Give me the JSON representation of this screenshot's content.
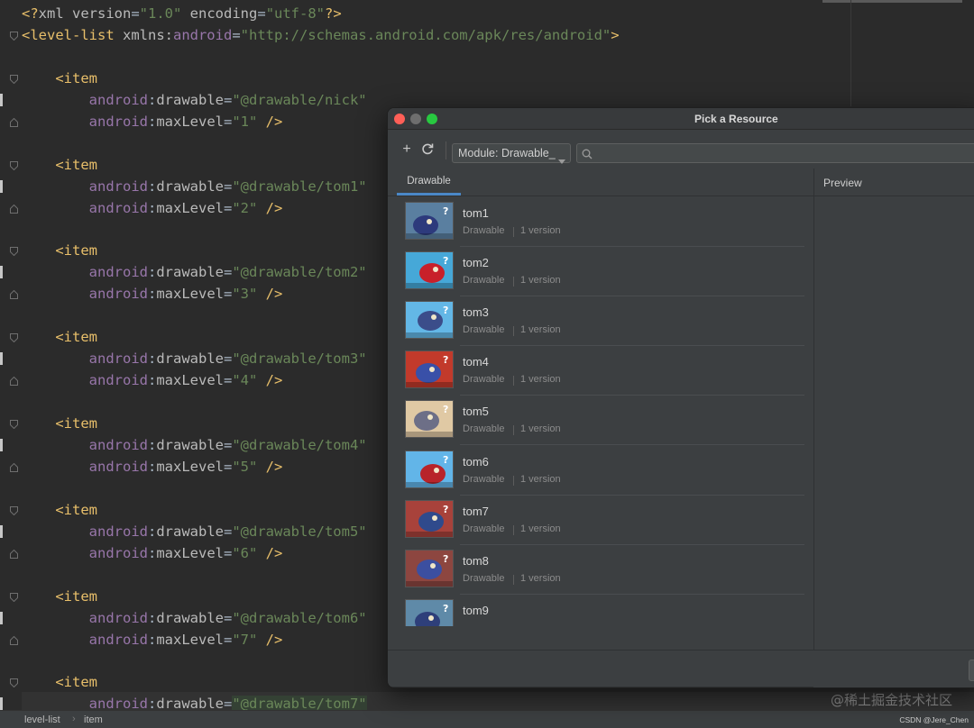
{
  "editor": {
    "lines": [
      [
        [
          "t-decl",
          "<?"
        ],
        [
          "t-attr",
          "xml version"
        ],
        [
          "",
          "="
        ],
        [
          "t-val",
          "\"1.0\""
        ],
        [
          "t-attr",
          " encoding"
        ],
        [
          "",
          "="
        ],
        [
          "t-val",
          "\"utf-8\""
        ],
        [
          "t-decl",
          "?>"
        ]
      ],
      [
        [
          "t-tag",
          "<level-list"
        ],
        [
          "t-attr",
          " xmlns:"
        ],
        [
          "t-ns",
          "android"
        ],
        [
          "",
          "="
        ],
        [
          "t-val",
          "\"http://schemas.android.com/apk/res/android\""
        ],
        [
          "t-tag",
          ">"
        ]
      ],
      [],
      [
        [
          "t-tag",
          "    <item"
        ]
      ],
      [
        [
          "t-ns",
          "        android"
        ],
        [
          "",
          ":"
        ],
        [
          "t-attr",
          "drawable"
        ],
        [
          "",
          "="
        ],
        [
          "t-val",
          "\"@drawable/nick\""
        ]
      ],
      [
        [
          "t-ns",
          "        android"
        ],
        [
          "",
          ":"
        ],
        [
          "t-attr",
          "maxLevel"
        ],
        [
          "",
          "="
        ],
        [
          "t-val",
          "\"1\""
        ],
        [
          "t-tag",
          " />"
        ]
      ],
      [],
      [
        [
          "t-tag",
          "    <item"
        ]
      ],
      [
        [
          "t-ns",
          "        android"
        ],
        [
          "",
          ":"
        ],
        [
          "t-attr",
          "drawable"
        ],
        [
          "",
          "="
        ],
        [
          "t-val",
          "\"@drawable/tom1\""
        ]
      ],
      [
        [
          "t-ns",
          "        android"
        ],
        [
          "",
          ":"
        ],
        [
          "t-attr",
          "maxLevel"
        ],
        [
          "",
          "="
        ],
        [
          "t-val",
          "\"2\""
        ],
        [
          "t-tag",
          " />"
        ]
      ],
      [],
      [
        [
          "t-tag",
          "    <item"
        ]
      ],
      [
        [
          "t-ns",
          "        android"
        ],
        [
          "",
          ":"
        ],
        [
          "t-attr",
          "drawable"
        ],
        [
          "",
          "="
        ],
        [
          "t-val",
          "\"@drawable/tom2\""
        ]
      ],
      [
        [
          "t-ns",
          "        android"
        ],
        [
          "",
          ":"
        ],
        [
          "t-attr",
          "maxLevel"
        ],
        [
          "",
          "="
        ],
        [
          "t-val",
          "\"3\""
        ],
        [
          "t-tag",
          " />"
        ]
      ],
      [],
      [
        [
          "t-tag",
          "    <item"
        ]
      ],
      [
        [
          "t-ns",
          "        android"
        ],
        [
          "",
          ":"
        ],
        [
          "t-attr",
          "drawable"
        ],
        [
          "",
          "="
        ],
        [
          "t-val",
          "\"@drawable/tom3\""
        ]
      ],
      [
        [
          "t-ns",
          "        android"
        ],
        [
          "",
          ":"
        ],
        [
          "t-attr",
          "maxLevel"
        ],
        [
          "",
          "="
        ],
        [
          "t-val",
          "\"4\""
        ],
        [
          "t-tag",
          " />"
        ]
      ],
      [],
      [
        [
          "t-tag",
          "    <item"
        ]
      ],
      [
        [
          "t-ns",
          "        android"
        ],
        [
          "",
          ":"
        ],
        [
          "t-attr",
          "drawable"
        ],
        [
          "",
          "="
        ],
        [
          "t-val",
          "\"@drawable/tom4\""
        ]
      ],
      [
        [
          "t-ns",
          "        android"
        ],
        [
          "",
          ":"
        ],
        [
          "t-attr",
          "maxLevel"
        ],
        [
          "",
          "="
        ],
        [
          "t-val",
          "\"5\""
        ],
        [
          "t-tag",
          " />"
        ]
      ],
      [],
      [
        [
          "t-tag",
          "    <item"
        ]
      ],
      [
        [
          "t-ns",
          "        android"
        ],
        [
          "",
          ":"
        ],
        [
          "t-attr",
          "drawable"
        ],
        [
          "",
          "="
        ],
        [
          "t-val",
          "\"@drawable/tom5\""
        ]
      ],
      [
        [
          "t-ns",
          "        android"
        ],
        [
          "",
          ":"
        ],
        [
          "t-attr",
          "maxLevel"
        ],
        [
          "",
          "="
        ],
        [
          "t-val",
          "\"6\""
        ],
        [
          "t-tag",
          " />"
        ]
      ],
      [],
      [
        [
          "t-tag",
          "    <item"
        ]
      ],
      [
        [
          "t-ns",
          "        android"
        ],
        [
          "",
          ":"
        ],
        [
          "t-attr",
          "drawable"
        ],
        [
          "",
          "="
        ],
        [
          "t-val",
          "\"@drawable/tom6\""
        ]
      ],
      [
        [
          "t-ns",
          "        android"
        ],
        [
          "",
          ":"
        ],
        [
          "t-attr",
          "maxLevel"
        ],
        [
          "",
          "="
        ],
        [
          "t-val",
          "\"7\""
        ],
        [
          "t-tag",
          " />"
        ]
      ],
      [],
      [
        [
          "t-tag",
          "    <item"
        ]
      ],
      [
        [
          "t-ns",
          "        android"
        ],
        [
          "",
          ":"
        ],
        [
          "t-attr",
          "drawable"
        ],
        [
          "",
          "="
        ],
        [
          "t-val t-hl",
          "\"@drawable/tom7\""
        ]
      ]
    ]
  },
  "statusbar": {
    "crumb1": "level-list",
    "crumb2": "item",
    "separator": "›",
    "watermark": "@稀土掘金技术社区",
    "credit": "CSDN @Jere_Chen"
  },
  "dialog": {
    "title": "Pick a Resource",
    "add_icon": "+",
    "refresh_icon": "refresh-icon",
    "module_label": "Module: Drawable_",
    "search_placeholder": "",
    "tab_label": "Drawable",
    "preview_label": "Preview",
    "resources": [
      {
        "name": "tom1",
        "type": "Drawable",
        "versions": "1 version",
        "bg": "#5a7fa0",
        "fg": "#2d3a7c"
      },
      {
        "name": "tom2",
        "type": "Drawable",
        "versions": "1 version",
        "bg": "#46a8d8",
        "fg": "#c8202a"
      },
      {
        "name": "tom3",
        "type": "Drawable",
        "versions": "1 version",
        "bg": "#63b7e6",
        "fg": "#3b4d8a"
      },
      {
        "name": "tom4",
        "type": "Drawable",
        "versions": "1 version",
        "bg": "#c23a2b",
        "fg": "#3950a8"
      },
      {
        "name": "tom5",
        "type": "Drawable",
        "versions": "1 version",
        "bg": "#e0c9a4",
        "fg": "#6d6f87"
      },
      {
        "name": "tom6",
        "type": "Drawable",
        "versions": "1 version",
        "bg": "#62b5e8",
        "fg": "#b8242a"
      },
      {
        "name": "tom7",
        "type": "Drawable",
        "versions": "1 version",
        "bg": "#a8423b",
        "fg": "#2f4a8c"
      },
      {
        "name": "tom8",
        "type": "Drawable",
        "versions": "1 version",
        "bg": "#8d4640",
        "fg": "#3c4fa0"
      },
      {
        "name": "tom9",
        "type": "",
        "versions": "",
        "bg": "#5f8aa8",
        "fg": "#2e3f7a"
      }
    ]
  }
}
